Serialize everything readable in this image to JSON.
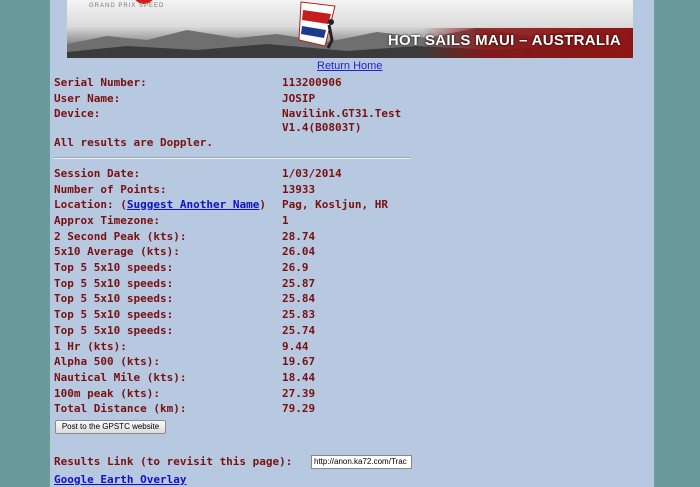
{
  "banner": {
    "logo_text": "GRAND PRIX SPEED",
    "tagline": "HOT SAILS MAUI – AUSTRALIA"
  },
  "nav": {
    "return_home": "Return Home"
  },
  "device_info": {
    "serial_label": "Serial Number:",
    "serial_value": "113200906",
    "user_label": "User Name:",
    "user_value": "JOSIP",
    "device_label": "Device:",
    "device_value_line1": "Navilink.GT31.Test",
    "device_value_line2": "V1.4(B0803T)",
    "doppler_note": "All results are Doppler."
  },
  "session": {
    "date_label": "Session Date:",
    "date_value": "1/03/2014",
    "points_label": "Number of Points:",
    "points_value": "13933",
    "location_label_prefix": "Location: (",
    "location_link": "Suggest Another Name",
    "location_label_suffix": ")",
    "location_value": "Pag, Kosljun, HR",
    "timezone_label": "Approx Timezone:",
    "timezone_value": "1"
  },
  "stats": [
    {
      "label": "2 Second Peak (kts):",
      "value": "28.74"
    },
    {
      "label": "5x10 Average (kts):",
      "value": "26.04"
    },
    {
      "label": "Top 5 5x10 speeds:",
      "value": "26.9"
    },
    {
      "label": "Top 5 5x10 speeds:",
      "value": "25.87"
    },
    {
      "label": "Top 5 5x10 speeds:",
      "value": "25.84"
    },
    {
      "label": "Top 5 5x10 speeds:",
      "value": "25.83"
    },
    {
      "label": "Top 5 5x10 speeds:",
      "value": "25.74"
    },
    {
      "label": "1 Hr (kts):",
      "value": "9.44"
    },
    {
      "label": "Alpha 500 (kts):",
      "value": "19.67"
    },
    {
      "label": "Nautical Mile (kts):",
      "value": "18.44"
    },
    {
      "label": "100m peak (kts):",
      "value": "27.39"
    },
    {
      "label": "Total Distance (km):",
      "value": "79.29"
    }
  ],
  "actions": {
    "post_button": "Post to the GPSTC website",
    "results_link_label": "Results Link (to revisit this page):",
    "results_link_value": "http://anon.ka72.com/Trac",
    "google_earth": "Google Earth Overlay"
  }
}
